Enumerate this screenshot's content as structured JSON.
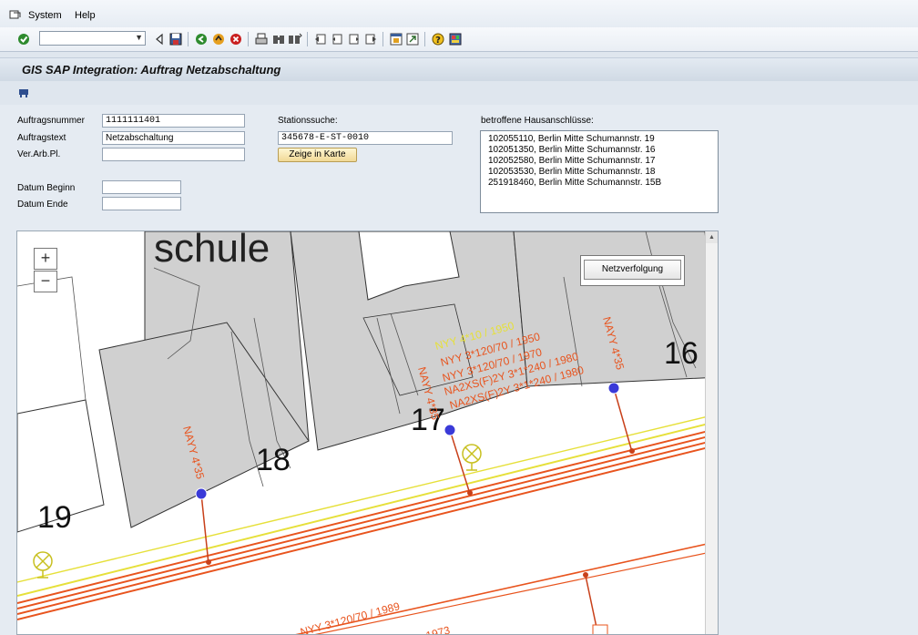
{
  "menu": {
    "system": "System",
    "help": "Help"
  },
  "window": {
    "title": "GIS SAP Integration: Auftrag Netzabschaltung"
  },
  "form": {
    "auftragsnummer_label": "Auftragsnummer",
    "auftragsnummer_value": "1111111401",
    "auftragstext_label": "Auftragstext",
    "auftragstext_value": "Netzabschaltung",
    "verarbpl_label": "Ver.Arb.Pl.",
    "verarbpl_value": "",
    "datum_beginn_label": "Datum Beginn",
    "datum_beginn_value": "",
    "datum_ende_label": "Datum Ende",
    "datum_ende_value": "",
    "stationssuche_label": "Stationssuche:",
    "stationssuche_value": "345678-E-ST-0010",
    "zeige_button": "Zeige in Karte",
    "hausanschluesse_label": "betroffene Hausanschlüsse:",
    "hausanschluesse": [
      "102055110, Berlin Mitte Schumannstr. 19",
      "102051350, Berlin Mitte Schumannstr. 16",
      "102052580, Berlin Mitte Schumannstr. 17",
      "102053530, Berlin Mitte Schumannstr. 18",
      "251918460, Berlin Mitte Schumannstr. 15B"
    ]
  },
  "map": {
    "zoom_in": "+",
    "zoom_out": "−",
    "netzverfolgung_button": "Netzverfolgung",
    "building_labels": {
      "schule": "schule",
      "b16": "16",
      "b17": "17",
      "b18": "18",
      "b19": "19"
    },
    "cable_labels": {
      "nayy_18": "NAYY 4*35",
      "nayy_17": "NAYY 4*35",
      "nayy_16": "NAYY 4*35",
      "yellow_top": "NYY 4*10 / 1950",
      "nyy_1950": "NYY 3*120/70 / 1950",
      "nyy_1970": "NYY 3*120/70 / 1970",
      "na2xs_1": "NA2XS(F)2Y 3*1*240 / 1980",
      "na2xs_2": "NA2XS(F)2Y 3*1*240 / 1980",
      "nyy_1989": "NYY 3*120/70 / 1989",
      "bottom_partial": "1973"
    },
    "colors": {
      "cable": "#e8541e",
      "yellow_line": "#e6e03a",
      "connection_point": "#3a3ad8",
      "building_fill": "#d0d0d0"
    }
  },
  "icons": [
    "sap-menu-icon",
    "check-icon",
    "back-icon",
    "save-icon",
    "green-arrow-icon",
    "exit-icon",
    "cancel-icon",
    "print-icon",
    "find-icon",
    "find-next-icon",
    "first-page-icon",
    "prev-page-icon",
    "next-page-icon",
    "last-page-icon",
    "create-session-icon",
    "shortcut-icon",
    "help-icon",
    "layout-icon",
    "tools-icon"
  ]
}
